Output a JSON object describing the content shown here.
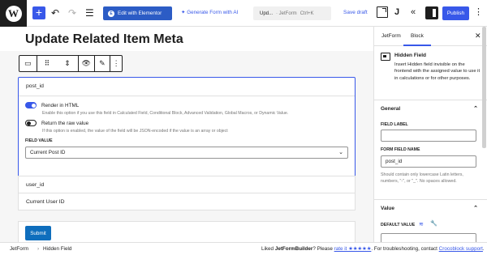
{
  "topbar": {
    "logo_glyph": "W",
    "add_glyph": "+",
    "undo_glyph": "↶",
    "redo_glyph": "↷",
    "tools_glyph": "☰",
    "edit_elementor_label": "Edit with Elementor",
    "elementor_glyph": "E",
    "generate_ai_label": "Generate Form with AI",
    "command_label": "Upd...",
    "command_context": "· JetForm",
    "command_shortcut": "Ctrl+K",
    "save_draft_label": "Save draft",
    "jetform_glyph": "J",
    "collapse_glyph": "«",
    "publish_label": "Publish",
    "more_glyph": "⋮"
  },
  "canvas": {
    "page_title": "Update Related Item Meta",
    "block_toolbar": {
      "transform_glyph": "▭",
      "move_glyph": "⇕",
      "visibility_glyph": "👁",
      "style_glyph": "✎",
      "more_glyph": "⋮"
    },
    "field_block": {
      "field_name": "post_id",
      "render_html_label": "Render in HTML",
      "render_html_on": true,
      "render_html_help": "Enable this option if you use this field in Calculated Field, Conditional Block, Advanced Validation, Global Macros, or Dynamic Value.",
      "raw_value_label": "Return the raw value",
      "raw_value_on": false,
      "raw_value_help": "If this option is enabled, the value of the field will be JSON-encoded if the value is an array or object",
      "field_value_label": "FIELD VALUE",
      "field_value_selected": "Current Post ID",
      "select_chevron": "⌄"
    },
    "user_field_name": "user_id",
    "user_field_value": "Current User ID",
    "submit_label": "Submit"
  },
  "sidebar": {
    "tabs": [
      "JetForm",
      "Block"
    ],
    "active_tab": "Block",
    "close_glyph": "✕",
    "block_title": "Hidden Field",
    "block_description": "Insert Hidden field invisible on the frontend with the assigned value to use it in calculations or for other purposes.",
    "general_title": "General",
    "field_label_caption": "FIELD LABEL",
    "field_label_value": "",
    "form_field_name_caption": "FORM FIELD NAME",
    "form_field_name_value": "post_id",
    "form_field_name_help": "Should contain only lowercase Latin letters, numbers, \"-\", or \"_\". No spaces allowed.",
    "value_title": "Value",
    "default_value_caption": "DEFAULT VALUE",
    "default_value_value": "",
    "chevron_up_glyph": "⌃",
    "db_glyph": "≋",
    "wrench_glyph": "🔧"
  },
  "footer": {
    "breadcrumbs": [
      "JetForm",
      "Hidden Field"
    ],
    "separator": "›",
    "feedback_prefix": "Liked ",
    "feedback_brand": "JetFormBuilder",
    "feedback_middle": "? Please ",
    "rate_link": "rate it ★★★★★",
    "feedback_suffix": ". For troubleshooting, contact ",
    "support_link": "Crocoblock support",
    "feedback_end": "."
  },
  "colors": {
    "accent": "#3858e9",
    "elementor": "#2c5cc5",
    "submit": "#0f6ebd",
    "text": "#1e1e1e",
    "muted": "#757575"
  }
}
